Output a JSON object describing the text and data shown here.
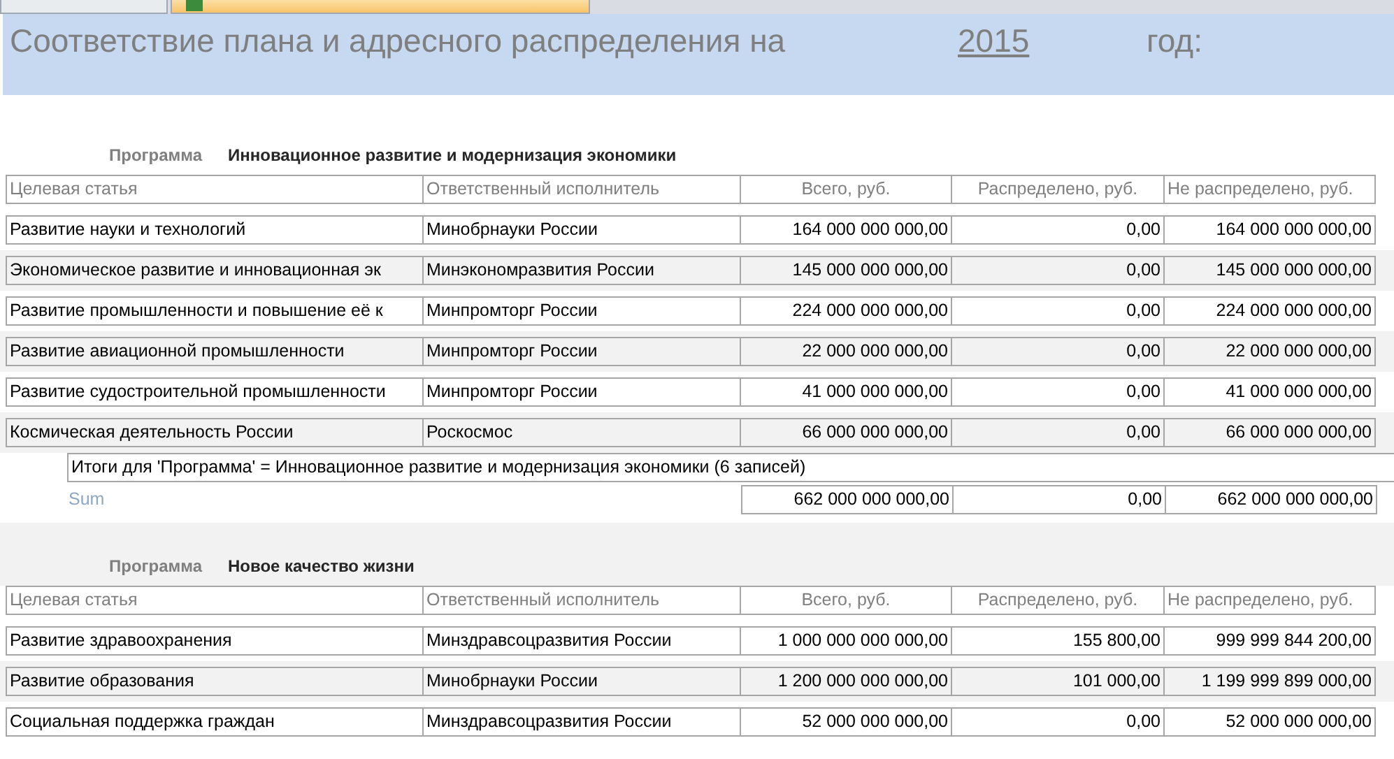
{
  "tabs": [
    {
      "selected": false
    },
    {
      "selected": true
    }
  ],
  "header": {
    "title": "Соответствие плана и адресного распределения на",
    "year": "2015",
    "suffix": "год:"
  },
  "groups": [
    {
      "label": "Программа",
      "value": "Инновационное развитие и модернизация экономики",
      "columns": [
        "Целевая статья",
        "Ответственный исполнитель",
        "Всего, руб.",
        "Распределено, руб.",
        "Не распределено, руб."
      ],
      "rows": [
        [
          "Развитие науки и технологий",
          "Минобрнауки России",
          "164 000 000 000,00",
          "0,00",
          "164 000 000 000,00"
        ],
        [
          "Экономическое развитие и инновационная эк",
          "Минэкономразвития России",
          "145 000 000 000,00",
          "0,00",
          "145 000 000 000,00"
        ],
        [
          "Развитие промышленности и повышение её к",
          "Минпромторг России",
          "224 000 000 000,00",
          "0,00",
          "224 000 000 000,00"
        ],
        [
          "Развитие авиационной промышленности",
          "Минпромторг России",
          "22 000 000 000,00",
          "0,00",
          "22 000 000 000,00"
        ],
        [
          "Развитие судостроительной промышленности",
          "Минпромторг России",
          "41 000 000 000,00",
          "0,00",
          "41 000 000 000,00"
        ],
        [
          "Космическая деятельность России",
          "Роскосмос",
          "66 000 000 000,00",
          "0,00",
          "66 000 000 000,00"
        ]
      ],
      "summary": "Итоги для 'Программа' =  Инновационное развитие и модернизация экономики (6 записей)",
      "sum_label": "Sum",
      "sum": [
        "662 000 000 000,00",
        "0,00",
        "662 000 000 000,00"
      ]
    },
    {
      "label": "Программа",
      "value": "Новое качество жизни",
      "columns": [
        "Целевая статья",
        "Ответственный исполнитель",
        "Всего, руб.",
        "Распределено, руб.",
        "Не распределено, руб."
      ],
      "rows": [
        [
          "Развитие здравоохранения",
          "Минздравсоцразвития России",
          "1 000 000 000 000,00",
          "155 800,00",
          "999 999 844 200,00"
        ],
        [
          "Развитие образования",
          "Минобрнауки России",
          "1 200 000 000 000,00",
          "101 000,00",
          "1 199 999 899 000,00"
        ],
        [
          "Социальная поддержка граждан",
          "Минздравсоцразвития России",
          "52 000 000 000,00",
          "0,00",
          "52 000 000 000,00"
        ]
      ]
    }
  ]
}
